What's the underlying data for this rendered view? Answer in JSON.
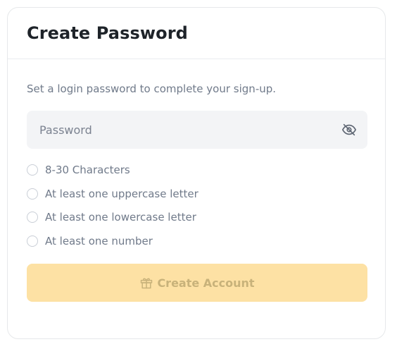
{
  "header": {
    "title": "Create Password"
  },
  "form": {
    "subtitle": "Set a login password to complete your sign-up.",
    "password": {
      "placeholder": "Password",
      "value": "",
      "visibility_icon": "eye-slash-icon"
    },
    "requirements": [
      {
        "label": "8-30 Characters",
        "met": false
      },
      {
        "label": "At least one uppercase letter",
        "met": false
      },
      {
        "label": "At least one lowercase letter",
        "met": false
      },
      {
        "label": "At least one number",
        "met": false
      }
    ],
    "submit": {
      "label": "Create Account",
      "icon": "gift-icon",
      "disabled": true
    }
  },
  "colors": {
    "accent_disabled": "#fde1a4",
    "text_primary": "#1e2329",
    "text_secondary": "#707a8a",
    "input_bg": "#f3f4f6"
  }
}
